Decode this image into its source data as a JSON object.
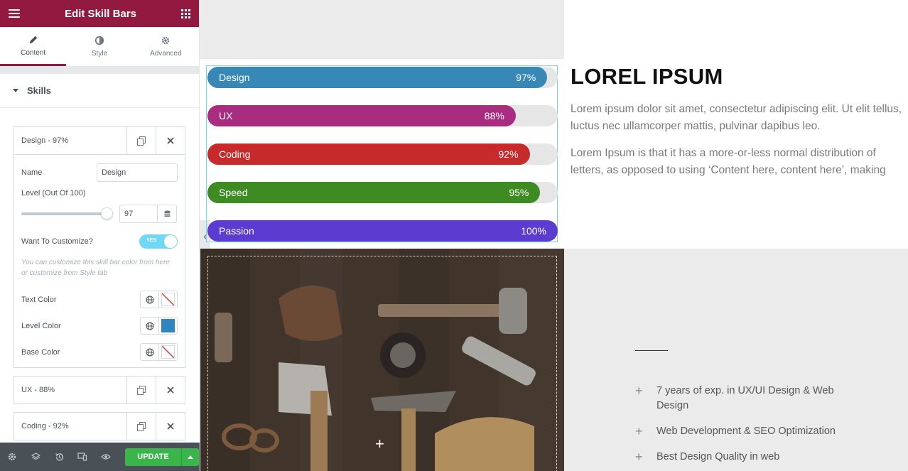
{
  "panel": {
    "title": "Edit Skill Bars",
    "tabs": [
      {
        "label": "Content"
      },
      {
        "label": "Style"
      },
      {
        "label": "Advanced"
      }
    ],
    "section_title": "Skills",
    "open_item": {
      "title": "Design - 97%",
      "name_label": "Name",
      "name_value": "Design",
      "level_label": "Level (Out Of 100)",
      "level_value": "97",
      "level_fraction": 0.97,
      "customize_label": "Want To Customize?",
      "toggle_text": "YES",
      "hint": "You can customize this skill bar color from here or customize from Style tab",
      "text_color_label": "Text Color",
      "level_color_label": "Level Color",
      "level_color": "#2e86c1",
      "base_color_label": "Base Color"
    },
    "collapsed_items": [
      {
        "title": "UX - 88%"
      },
      {
        "title": "Coding - 92%"
      }
    ],
    "footer": {
      "update_label": "UPDATE"
    },
    "header_color": "#92193f"
  },
  "canvas": {
    "bars": [
      {
        "name": "Design",
        "percent_label": "97%",
        "value": 97,
        "color": "#3788b7"
      },
      {
        "name": "UX",
        "percent_label": "88%",
        "value": 88,
        "color": "#a82c7f"
      },
      {
        "name": "Coding",
        "percent_label": "92%",
        "value": 92,
        "color": "#c62a2a"
      },
      {
        "name": "Speed",
        "percent_label": "95%",
        "value": 95,
        "color": "#3e8b24"
      },
      {
        "name": "Passion",
        "percent_label": "100%",
        "value": 100,
        "color": "#5a3cd0"
      }
    ],
    "heading": "LOREL IPSUM",
    "para1_line1": "Lorem ipsum dolor sit amet, consectetur adipiscing elit. Ut elit tellus,",
    "para1_line2": "luctus nec ullamcorper mattis, pulvinar dapibus leo.",
    "para2_line1": "Lorem Ipsum is that it has a more-or-less normal distribution of",
    "para2_line2": "letters, as opposed to using ‘Content here, content here’, making",
    "list": [
      {
        "text": "7 years of exp. in UX/UI Design & Web Design"
      },
      {
        "text": "Web Development & SEO Optimization"
      },
      {
        "text": "Best Design Quality in web"
      }
    ]
  }
}
